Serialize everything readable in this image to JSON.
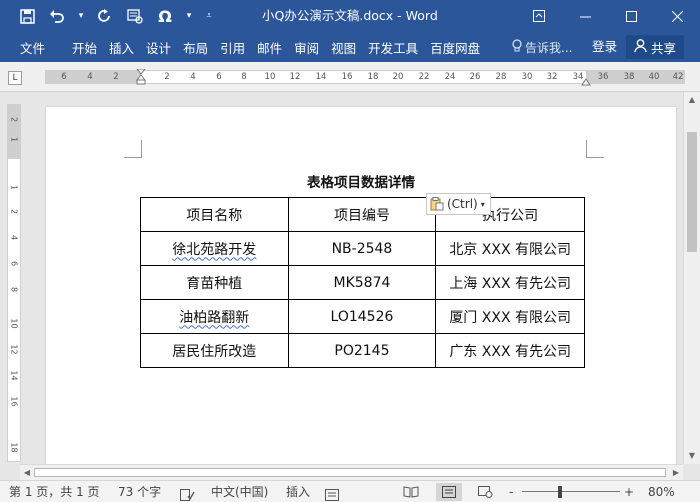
{
  "title_bar": {
    "document_title": "小Q办公演示文稿.docx - Word",
    "icons": [
      "save-icon",
      "undo-icon",
      "redo-icon",
      "format-icon",
      "omega-icon",
      "customize-icon"
    ],
    "window_controls": [
      "ribbon-display-icon",
      "minimize-icon",
      "maximize-icon",
      "close-icon"
    ]
  },
  "ribbon": {
    "tabs": [
      "文件",
      "开始",
      "插入",
      "设计",
      "布局",
      "引用",
      "邮件",
      "审阅",
      "视图",
      "开发工具",
      "百度网盘"
    ],
    "tell_me": "告诉我...",
    "login": "登录",
    "share": "共享"
  },
  "ruler": {
    "corner": "L",
    "numbers": [
      "6",
      "4",
      "2",
      "2",
      "4",
      "6",
      "8",
      "10",
      "12",
      "14",
      "16",
      "18",
      "20",
      "22",
      "24",
      "26",
      "28",
      "30",
      "32",
      "34",
      "36",
      "38",
      "40",
      "42"
    ],
    "vertical_numbers": [
      "2",
      "1",
      "1",
      "2",
      "4",
      "6",
      "8",
      "10",
      "12",
      "14",
      "16",
      "18"
    ]
  },
  "document": {
    "heading": "表格项目数据详情",
    "paste_options": "(Ctrl)",
    "table": {
      "headers": [
        "项目名称",
        "项目编号",
        "执行公司"
      ],
      "rows": [
        [
          "徐北苑路开发",
          "NB-2548",
          "北京 XXX 有限公司"
        ],
        [
          "育苗种植",
          "MK5874",
          "上海 XXX 有先公司"
        ],
        [
          "油柏路翻新",
          "LO14526",
          "厦门 XXX 有限公司"
        ],
        [
          "居民住所改造",
          "PO2145",
          "广东 XXX 有先公司"
        ]
      ]
    }
  },
  "status_bar": {
    "page": "第 1 页，共 1 页",
    "words": "73 个字",
    "language": "中文(中国)",
    "mode": "插入",
    "zoom_minus": "-",
    "zoom_plus": "+",
    "zoom": "80%"
  },
  "colors": {
    "accent": "#2b579a",
    "squiggle": "#4472c4"
  }
}
